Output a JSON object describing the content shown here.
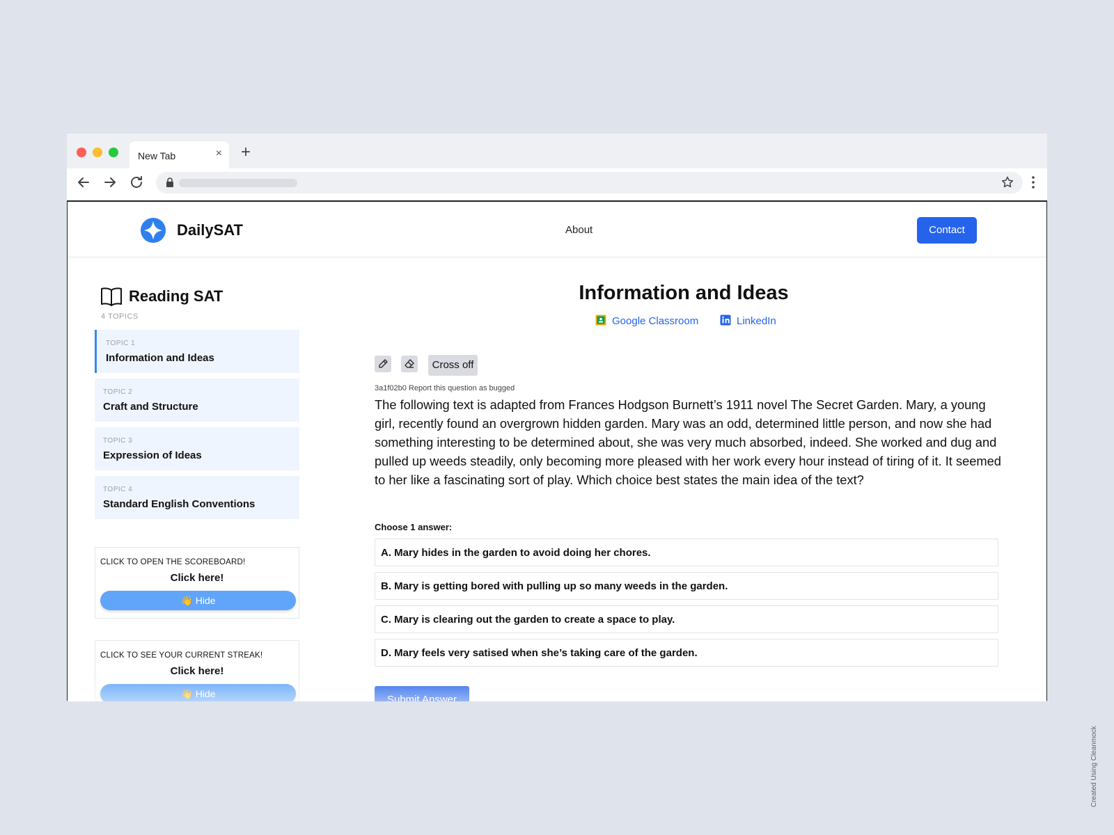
{
  "browser": {
    "tab_title": "New Tab",
    "tab_close": "×",
    "new_tab": "+"
  },
  "site": {
    "brand": "DailySAT",
    "nav_about": "About",
    "contact_label": "Contact",
    "accent": "#2563eb"
  },
  "sidebar": {
    "title": "Reading SAT",
    "count": "4 TOPICS",
    "topics": [
      {
        "number": "TOPIC 1",
        "name": "Information and Ideas",
        "active": true
      },
      {
        "number": "TOPIC 2",
        "name": "Craft and Structure",
        "active": false
      },
      {
        "number": "TOPIC 3",
        "name": "Expression of Ideas",
        "active": false
      },
      {
        "number": "TOPIC 4",
        "name": "Standard English Conventions",
        "active": false
      }
    ],
    "cards": [
      {
        "label": "CLICK TO OPEN THE SCOREBOARD!",
        "click": "Click here!",
        "hide": "👋  Hide"
      },
      {
        "label": "CLICK TO SEE YOUR CURRENT STREAK!",
        "click": "Click here!",
        "hide": "👋  Hide"
      }
    ]
  },
  "question": {
    "title": "Information and Ideas",
    "share": [
      {
        "label": "Google Classroom",
        "icon": "google-classroom-icon"
      },
      {
        "label": "LinkedIn",
        "icon": "linkedin-icon"
      }
    ],
    "tools": {
      "pencil_icon": "pencil-icon",
      "eraser_icon": "eraser-icon",
      "cross_off": "Cross off"
    },
    "id_line": "3a1f02b0 Report this question as bugged",
    "passage": "The following text is adapted from Frances Hodgson Burnett’s 1911 novel The Secret Garden. Mary, a young girl, recently found an overgrown hidden garden. Mary was an odd, determined little person, and now she had something interesting to be determined about, she was very much absorbed, indeed. She worked and dug and pulled up weeds steadily, only becoming more pleased with her work every hour instead of tiring of it. It seemed to her like a fascinating sort of play. Which choice best states the main idea of the text?",
    "choose_label": "Choose 1 answer:",
    "answers": [
      "A. Mary hides in the garden to avoid doing her chores.",
      "B. Mary is getting bored with pulling up so many weeds in the garden.",
      "C. Mary is clearing out the garden to create a space to play.",
      "D. Mary feels very satised when she’s taking care of the garden."
    ],
    "submit_label": "Submit Answer"
  },
  "watermark": "Created Using Cleanmock"
}
